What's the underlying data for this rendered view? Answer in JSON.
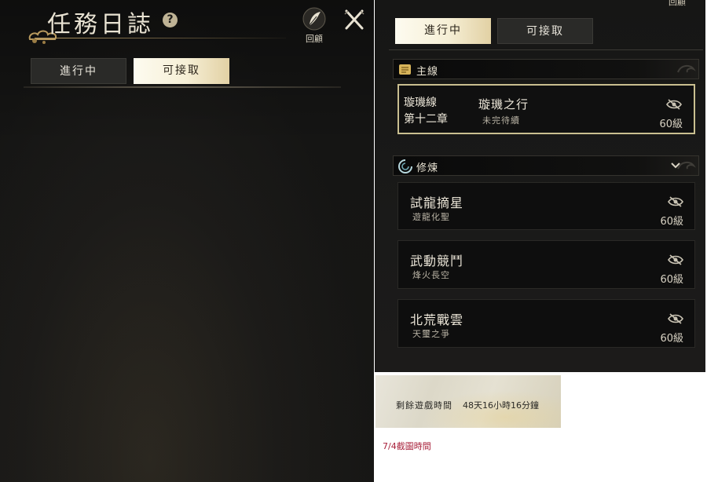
{
  "left": {
    "title": "任務日誌",
    "help_icon": "?",
    "recall_label": "回顧",
    "tabs": [
      {
        "label": "進行中",
        "active": false
      },
      {
        "label": "可接取",
        "active": true
      }
    ]
  },
  "right": {
    "recall_label": "回顧",
    "tabs": [
      {
        "label": "進行中",
        "active": true
      },
      {
        "label": "可接取",
        "active": false
      }
    ],
    "sections": [
      {
        "label": "主線",
        "icon": "scroll-icon",
        "quests": [
          {
            "chapter_name": "璇璣線",
            "chapter_number": "第十二章",
            "title": "璇璣之行",
            "subtitle": "未完待續",
            "level": "60級",
            "selected": true
          }
        ]
      },
      {
        "label": "修煉",
        "icon": "swirl-icon",
        "quests": [
          {
            "title": "試龍摘星",
            "subtitle": "遊龍化聖",
            "level": "60級"
          },
          {
            "title": "武動競鬥",
            "subtitle": "烽火長空",
            "level": "60級"
          },
          {
            "title": "北荒戰雲",
            "subtitle": "天璽之爭",
            "level": "60級"
          }
        ]
      }
    ]
  },
  "time_box": {
    "label": "剩餘遊戲時間",
    "value": "48天16小時16分鐘"
  },
  "caption": "7/4截圖時間",
  "colors": {
    "panel_bg": "#151514",
    "active_tab": "#f6efd6",
    "selected_border": "#c9bf90",
    "caption_red": "#a8203a"
  }
}
